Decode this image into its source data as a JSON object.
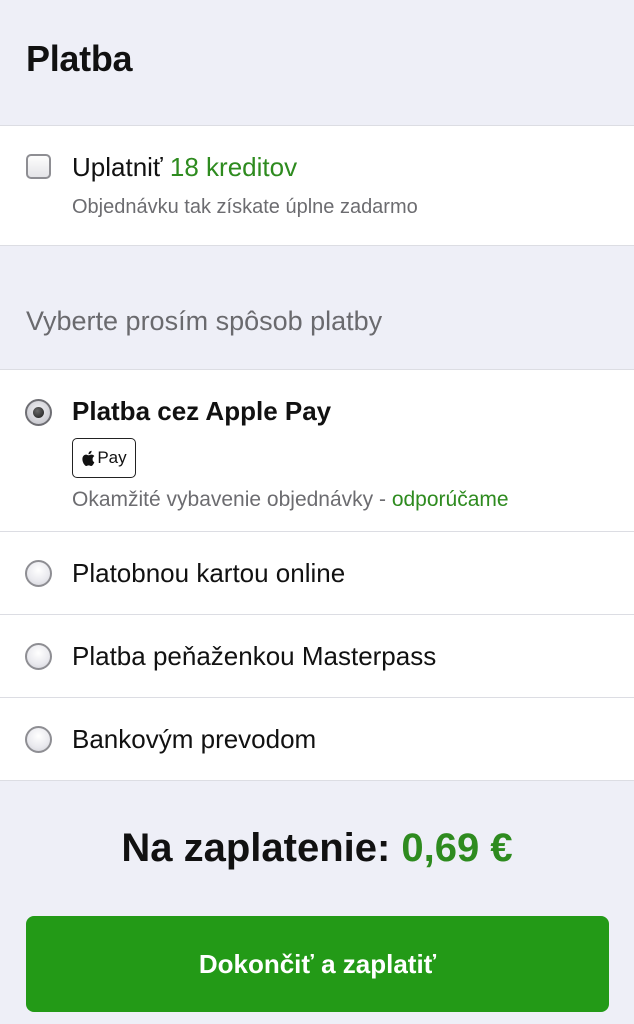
{
  "header": {
    "title": "Platba"
  },
  "credits": {
    "label_prefix": "Uplatniť ",
    "label_amount": "18 kreditov",
    "subtitle": "Objednávku tak získate úplne zadarmo",
    "checked": false
  },
  "payment": {
    "heading": "Vyberte prosím spôsob platby",
    "options": [
      {
        "label": "Platba cez Apple Pay",
        "badge_text": "Pay",
        "badge_icon": "apple-icon",
        "note_prefix": "Okamžité vybavenie objednávky - ",
        "note_highlight": "odporúčame",
        "selected": true
      },
      {
        "label": "Platobnou kartou online",
        "selected": false
      },
      {
        "label": "Platba peňaženkou Masterpass",
        "selected": false
      },
      {
        "label": "Bankovým prevodom",
        "selected": false
      }
    ]
  },
  "total": {
    "label": "Na zaplatenie: ",
    "amount": "0,69 €"
  },
  "pay_button": {
    "label": "Dokončiť a zaplatiť"
  },
  "colors": {
    "accent_green": "#2e8b1f",
    "button_green": "#239a17",
    "background": "#eeeff7"
  }
}
